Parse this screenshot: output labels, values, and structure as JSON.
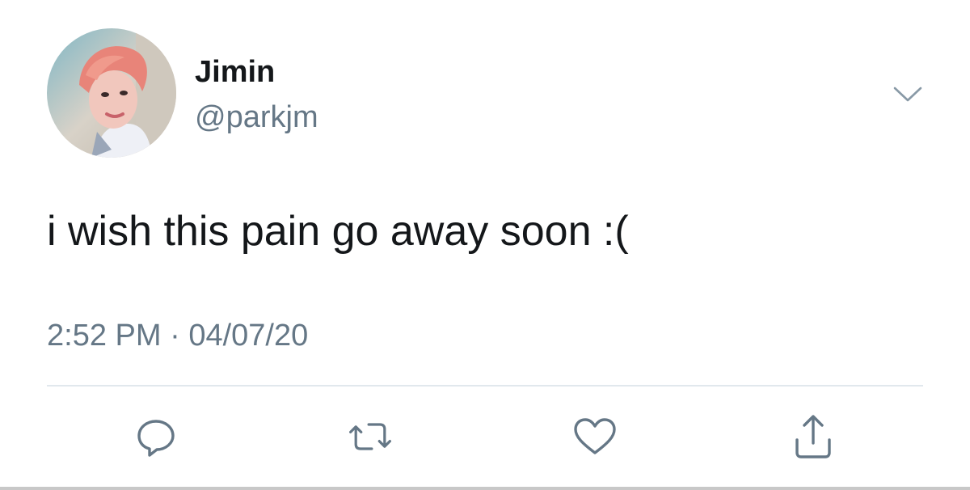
{
  "tweet": {
    "display_name": "Jimin",
    "handle": "@parkjm",
    "text": "i wish this pain go away soon :(",
    "time": "2:52 PM",
    "separator": "·",
    "date": "04/07/20"
  },
  "icons": {
    "menu": "chevron-down-icon",
    "reply": "comment-icon",
    "retweet": "retweet-icon",
    "like": "heart-icon",
    "share": "share-icon"
  },
  "colors": {
    "text_primary": "#14171a",
    "text_secondary": "#657786",
    "divider": "#e1e8ed"
  }
}
